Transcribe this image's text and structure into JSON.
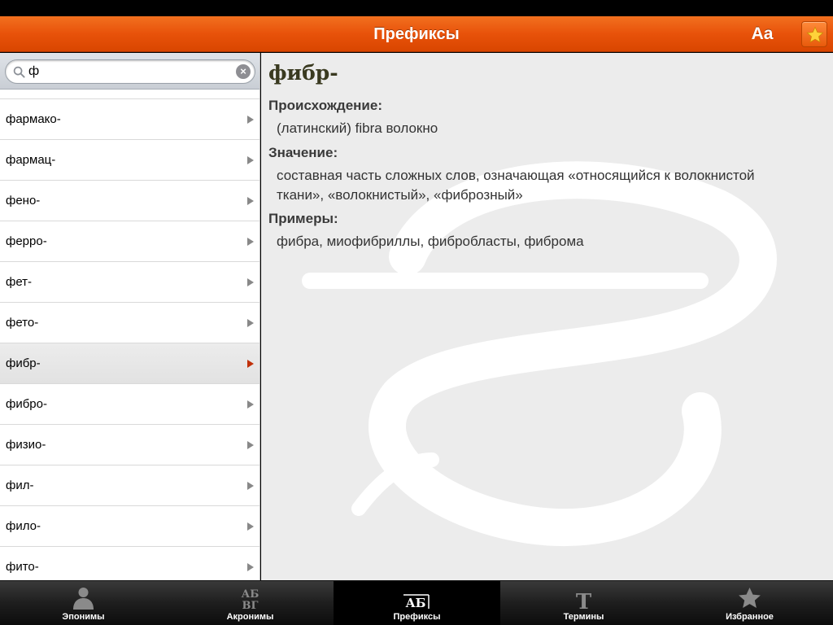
{
  "header": {
    "title": "Префиксы",
    "font_button_label": "Aa",
    "favorite_icon": "star-icon",
    "accent_color": "#e8520a"
  },
  "search": {
    "value": "ф",
    "icon": "magnifier-icon",
    "clear_icon": "clear-icon"
  },
  "list": {
    "items": [
      {
        "label": "фармако-"
      },
      {
        "label": "фармац-"
      },
      {
        "label": "фено-"
      },
      {
        "label": "ферро-"
      },
      {
        "label": "фет-"
      },
      {
        "label": "фето-"
      },
      {
        "label": "фибр-",
        "selected": true
      },
      {
        "label": "фибро-"
      },
      {
        "label": "физио-"
      },
      {
        "label": "фил-"
      },
      {
        "label": "фило-"
      },
      {
        "label": "фито-"
      }
    ]
  },
  "detail": {
    "term": "фибр-",
    "origin_label": "Происхождение:",
    "origin_text": "(латинский) fibra волокно",
    "meaning_label": "Значение:",
    "meaning_text": "составная часть сложных слов, означающая «относящийся к волокнистой ткани», «волокнистый», «фиброзный»",
    "examples_label": "Примеры:",
    "examples_text": "фибра, миофибриллы, фибробласты, фиброма"
  },
  "tabs": [
    {
      "label": "Эпонимы",
      "icon": "person-icon"
    },
    {
      "label": "Акронимы",
      "icon": "letters-icon"
    },
    {
      "label": "Префиксы",
      "icon": "prefix-icon",
      "active": true
    },
    {
      "label": "Термины",
      "icon": "t-letter-icon"
    },
    {
      "label": "Избранное",
      "icon": "star-icon"
    }
  ]
}
